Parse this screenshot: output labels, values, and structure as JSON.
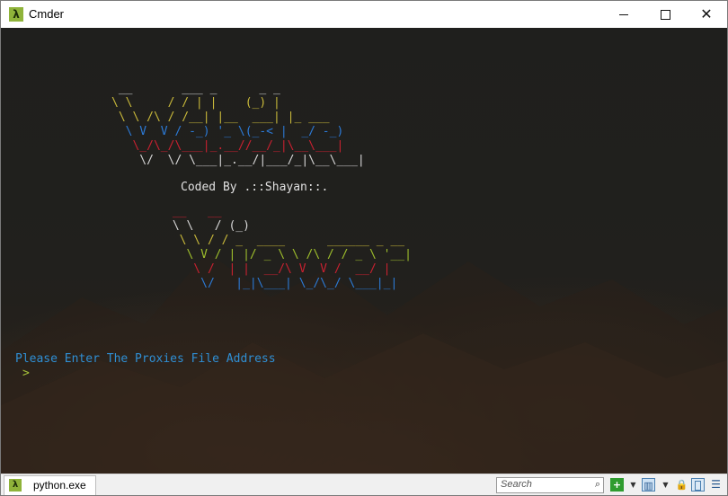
{
  "window": {
    "title": "Cmder",
    "app_icon": "lambda-icon",
    "app_icon_glyph": "λ",
    "controls": {
      "minimize": "minimize-icon",
      "maximize": "maximize-icon",
      "close_glyph": "✕"
    }
  },
  "terminal": {
    "banner_title": [
      {
        "text": " __       ___ _      _ _",
        "color": "#d6d6d6"
      },
      {
        "text": "\\ \\     / / | |    (_) |",
        "color": "#c8b83a"
      },
      {
        "text": " \\ \\ /\\ / /__| |__  ___| |_ ___",
        "color": "#c8b83a"
      },
      {
        "text": "  \\ V  V / -_) '_ \\(_-< |  _/ -_)",
        "color": "#2c7ad6"
      },
      {
        "text": "   \\_/\\_/\\___|_.__//__/_|\\__\\___|",
        "color": "#c92130"
      },
      {
        "text": "    \\/  \\/ \\___|_.__/|___/_|\\__\\___|",
        "color": "#d6d6d6"
      }
    ],
    "coded_by": "Coded By .::Shayan::.",
    "banner_viewer": [
      {
        "text": " __   __",
        "color": "#c92130"
      },
      {
        "text": " \\ \\   / (_)",
        "color": "#d6d6d6"
      },
      {
        "text": "  \\ \\ / / _  ____      ______ _ __",
        "color": "#c8b83a"
      },
      {
        "text": "   \\ V / | |/ _ \\ \\ /\\ / / _ \\ '__|",
        "color": "#9fbf2c"
      },
      {
        "text": "    \\ /  | |  __/\\ V  V /  __/ |",
        "color": "#c92130"
      },
      {
        "text": "     \\/   |_|\\___| \\_/\\_/ \\___|_|",
        "color": "#2c7ad6"
      }
    ],
    "prompt": "Please Enter The Proxies File Address",
    "caret": ">"
  },
  "statusbar": {
    "tab_label": "python.exe",
    "tab_icon": "lambda-icon",
    "tab_icon_glyph": "λ",
    "search_placeholder": "Search",
    "search_icon_glyph": "⌕",
    "add_glyph": "+",
    "dropdown_glyph": "▼",
    "lock_glyph": "🔒",
    "menu_glyph": "☰",
    "layout_glyph": "▥"
  },
  "colors": {
    "accent_green": "#8fb33a",
    "prompt_blue": "#2f8fd4",
    "caret_green": "#a6c23a",
    "banner_yellow": "#c8b83a",
    "banner_blue": "#2c7ad6",
    "banner_red": "#c92130"
  }
}
